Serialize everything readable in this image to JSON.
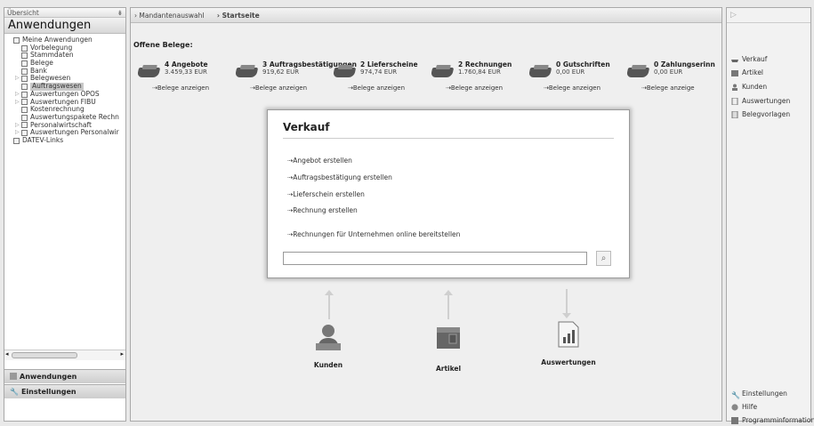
{
  "left": {
    "header": "Übersicht",
    "pin": "⇟",
    "title": "Anwendungen",
    "tree": [
      {
        "label": "Meine Anwendungen",
        "level": 0,
        "expand": ""
      },
      {
        "label": "Vorbelegung",
        "level": 1,
        "expand": ""
      },
      {
        "label": "Stammdaten",
        "level": 1,
        "expand": ""
      },
      {
        "label": "Belege",
        "level": 1,
        "expand": ""
      },
      {
        "label": "Bank",
        "level": 1,
        "expand": ""
      },
      {
        "label": "Belegwesen",
        "level": 1,
        "expand": "▷"
      },
      {
        "label": "Auftragswesen",
        "level": 1,
        "expand": "",
        "selected": true
      },
      {
        "label": "Auswertungen OPOS",
        "level": 1,
        "expand": "▷"
      },
      {
        "label": "Auswertungen FIBU",
        "level": 1,
        "expand": "▷"
      },
      {
        "label": "Kostenrechnung",
        "level": 1,
        "expand": ""
      },
      {
        "label": "Auswertungspakete Rechn",
        "level": 1,
        "expand": ""
      },
      {
        "label": "Personalwirtschaft",
        "level": 1,
        "expand": "▷"
      },
      {
        "label": "Auswertungen Personalwir",
        "level": 1,
        "expand": "▷"
      },
      {
        "label": "DATEV-Links",
        "level": 0,
        "expand": ""
      }
    ],
    "scroll_left": "◂",
    "scroll_right": "▸",
    "btn_apps": "Anwendungen",
    "btn_settings": "Einstellungen"
  },
  "breadcrumb": [
    "Mandantenauswahl",
    "Startseite"
  ],
  "offene_belege": "Offene Belege:",
  "docs": [
    {
      "count": "4 Angebote",
      "amount": "3.459,33 EUR",
      "link": "Belege anzeigen"
    },
    {
      "count": "3 Auftragsbestätigungen",
      "amount": "919,62 EUR",
      "link": "Belege anzeigen"
    },
    {
      "count": "2 Lieferscheine",
      "amount": "974,74 EUR",
      "link": "Belege anzeigen"
    },
    {
      "count": "2 Rechnungen",
      "amount": "1.760,84 EUR",
      "link": "Belege anzeigen"
    },
    {
      "count": "0 Gutschriften",
      "amount": "0,00 EUR",
      "link": "Belege anzeigen"
    },
    {
      "count": "0 Zahlungserinn",
      "amount": "0,00 EUR",
      "link": "Belege anzeige"
    }
  ],
  "verkauf": {
    "title": "Verkauf",
    "links": [
      "Angebot erstellen",
      "Auftragsbestätigung erstellen",
      "Lieferschein erstellen",
      "Rechnung erstellen",
      "Rechnungen für Unternehmen online bereitstellen"
    ],
    "search_value": ""
  },
  "bottom": [
    {
      "label": "Kunden",
      "icon": "customer-icon"
    },
    {
      "label": "Artikel",
      "icon": "article-icon"
    },
    {
      "label": "Auswertungen",
      "icon": "report-icon"
    }
  ],
  "right": {
    "top": "▷",
    "items": [
      "Verkauf",
      "Artikel",
      "Kunden",
      "Auswertungen",
      "Belegvorlagen"
    ],
    "bottom_items": [
      "Einstellungen",
      "Hilfe",
      "Programminformationen"
    ]
  }
}
